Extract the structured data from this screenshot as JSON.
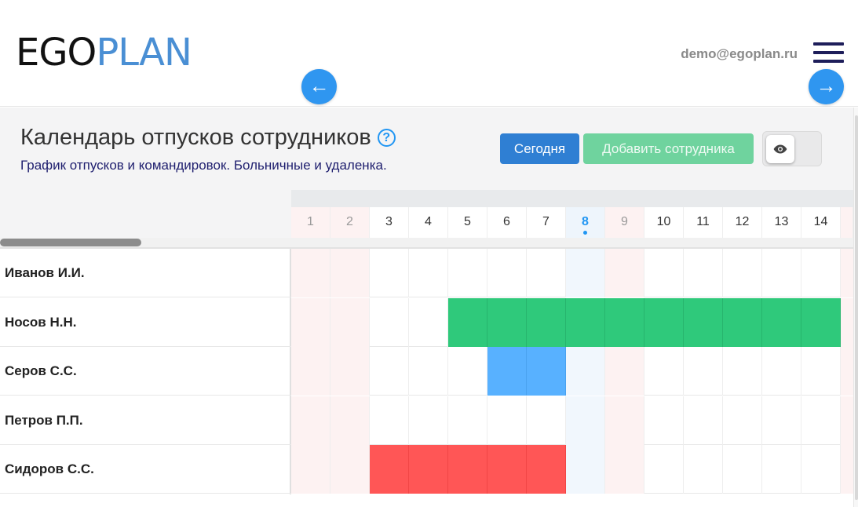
{
  "header": {
    "logo": {
      "part1": "EGO",
      "part2": "PLAN"
    },
    "user_email": "demo@egoplan.ru"
  },
  "panel": {
    "title": "Календарь отпусков сотрудников",
    "help_icon_glyph": "?",
    "subtitle": "График отпусков и командировок. Больничные и удаленка.",
    "today_button": "Сегодня",
    "add_button": "Добавить сотрудника"
  },
  "icons": [
    "menu-icon",
    "help-icon",
    "eye-icon",
    "arrow-left-icon",
    "arrow-right-icon"
  ],
  "colors": {
    "brand_dark": "#111111",
    "brand_blue": "#4a8fd4",
    "today_button": "#2f7fd3",
    "add_button": "#6fd39e",
    "vacation": "#2fc97b",
    "business_trip": "#58b1ff",
    "sick_leave": "#ff5656",
    "weekend": "#fdf2f2",
    "today_column": "#eef5fc"
  },
  "calendar": {
    "nav": {
      "prev": "←",
      "next": "→"
    },
    "today": 8,
    "days": [
      {
        "num": "1",
        "weekend": true
      },
      {
        "num": "2",
        "weekend": true
      },
      {
        "num": "3",
        "weekend": false
      },
      {
        "num": "4",
        "weekend": false
      },
      {
        "num": "5",
        "weekend": false
      },
      {
        "num": "6",
        "weekend": false
      },
      {
        "num": "7",
        "weekend": false
      },
      {
        "num": "8",
        "weekend": false
      },
      {
        "num": "9",
        "weekend": true
      },
      {
        "num": "10",
        "weekend": false
      },
      {
        "num": "11",
        "weekend": false
      },
      {
        "num": "12",
        "weekend": false
      },
      {
        "num": "13",
        "weekend": false
      },
      {
        "num": "14",
        "weekend": false
      }
    ],
    "employees": [
      {
        "name": "Иванов И.И.",
        "absences": []
      },
      {
        "name": "Носов Н.Н.",
        "absences": [
          {
            "type": "vacation",
            "from": 5,
            "to": 14
          }
        ]
      },
      {
        "name": "Серов С.С.",
        "absences": [
          {
            "type": "trip",
            "from": 6,
            "to": 7
          }
        ]
      },
      {
        "name": "Петров П.П.",
        "absences": []
      },
      {
        "name": "Сидоров С.С.",
        "absences": [
          {
            "type": "sick",
            "from": 3,
            "to": 7
          }
        ]
      }
    ]
  }
}
